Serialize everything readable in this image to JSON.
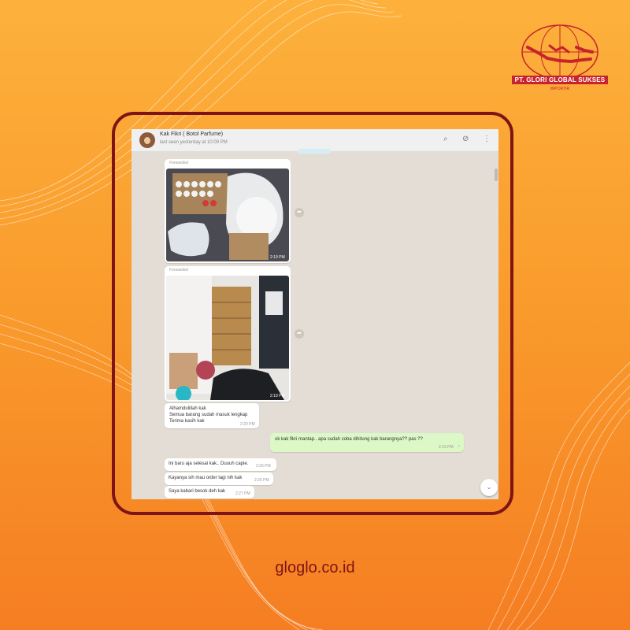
{
  "brand": {
    "company": "PT. GLORI GLOBAL SUKSES",
    "tagline": "IMPORTIR",
    "website": "gloglo.co.id",
    "colors": {
      "accent": "#7e1416",
      "logo_red": "#c8232c",
      "bg_top": "#fdb13c",
      "bg_bottom": "#f57e22"
    }
  },
  "chat": {
    "contact_name": "Kak Fikri ( Botol Parfume)",
    "last_seen": "last seen yesterday at 10:09 PM",
    "header_icons": [
      "search-icon",
      "attach-icon",
      "menu-icon"
    ],
    "messages": [
      {
        "type": "image",
        "direction": "in",
        "forwarded_label": "Forwarded",
        "time": "2:19 PM"
      },
      {
        "type": "image",
        "direction": "in",
        "forwarded_label": "Forwarded",
        "time": "2:19 PM"
      },
      {
        "type": "text",
        "direction": "in",
        "lines": [
          "Alhamdulillah kak",
          "Semua barang sudah masuk lengkap",
          "Terima kasih kak"
        ],
        "time": "2:20 PM"
      },
      {
        "type": "text",
        "direction": "out",
        "text": "ok kak fikri mantap.. apa sudah coba dihitung kak barangnya?? pas ??",
        "time": "2:23 PM"
      },
      {
        "type": "text",
        "direction": "in",
        "text": "Ini baru aja selesai kak.. Duuuh capie.",
        "time": "2:26 PM"
      },
      {
        "type": "text",
        "direction": "in",
        "text": "Kayanya sih mau order lagi nih kak",
        "time": "2:26 PM"
      },
      {
        "type": "text",
        "direction": "in",
        "text": "Saya kabari besok deh kak",
        "time": "2:27 PM"
      }
    ]
  }
}
